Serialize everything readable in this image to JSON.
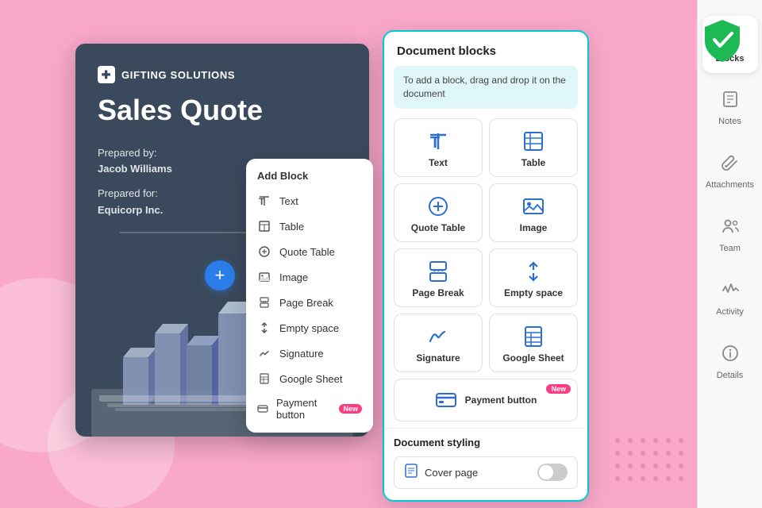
{
  "background": "#f9a8c9",
  "shield": {
    "color": "#1db954"
  },
  "doc_preview": {
    "logo_text": "GIFTING SOLUTIONS",
    "title": "Sales Quote",
    "prepared_by_label": "Prepared by:",
    "prepared_by_name": "Jacob Williams",
    "prepared_for_label": "Prepared for:",
    "prepared_for_name": "Equicorp Inc."
  },
  "add_block_dropdown": {
    "title": "Add Block",
    "items": [
      {
        "icon": "T↕",
        "label": "Text"
      },
      {
        "icon": "⊞",
        "label": "Table"
      },
      {
        "icon": "⊙",
        "label": "Quote Table"
      },
      {
        "icon": "🖼",
        "label": "Image"
      },
      {
        "icon": "⊓",
        "label": "Page Break"
      },
      {
        "icon": "↕",
        "label": "Empty space"
      },
      {
        "icon": "✒",
        "label": "Signature"
      },
      {
        "icon": "⊟",
        "label": "Google Sheet"
      },
      {
        "icon": "💳",
        "label": "Payment button",
        "is_new": true
      }
    ]
  },
  "blocks_panel": {
    "title": "Document blocks",
    "hint": "To add a block, drag and drop it on the document",
    "blocks": [
      {
        "icon": "text",
        "label": "Text"
      },
      {
        "icon": "table",
        "label": "Table"
      },
      {
        "icon": "quote",
        "label": "Quote Table"
      },
      {
        "icon": "image",
        "label": "Image"
      },
      {
        "icon": "pagebreak",
        "label": "Page Break"
      },
      {
        "icon": "emptyspace",
        "label": "Empty space"
      },
      {
        "icon": "signature",
        "label": "Signature"
      },
      {
        "icon": "googlesheet",
        "label": "Google Sheet"
      },
      {
        "icon": "payment",
        "label": "Payment button",
        "is_new": true
      }
    ],
    "styling_title": "Document styling",
    "cover_page_label": "Cover page"
  },
  "right_sidebar": {
    "items": [
      {
        "icon": "puzzle",
        "label": "Blocks",
        "active": true
      },
      {
        "icon": "note",
        "label": "Notes",
        "active": false
      },
      {
        "icon": "paperclip",
        "label": "Attachments",
        "active": false
      },
      {
        "icon": "team",
        "label": "Team",
        "active": false
      },
      {
        "icon": "activity",
        "label": "Activity",
        "active": false
      },
      {
        "icon": "info",
        "label": "Details",
        "active": false
      }
    ]
  }
}
